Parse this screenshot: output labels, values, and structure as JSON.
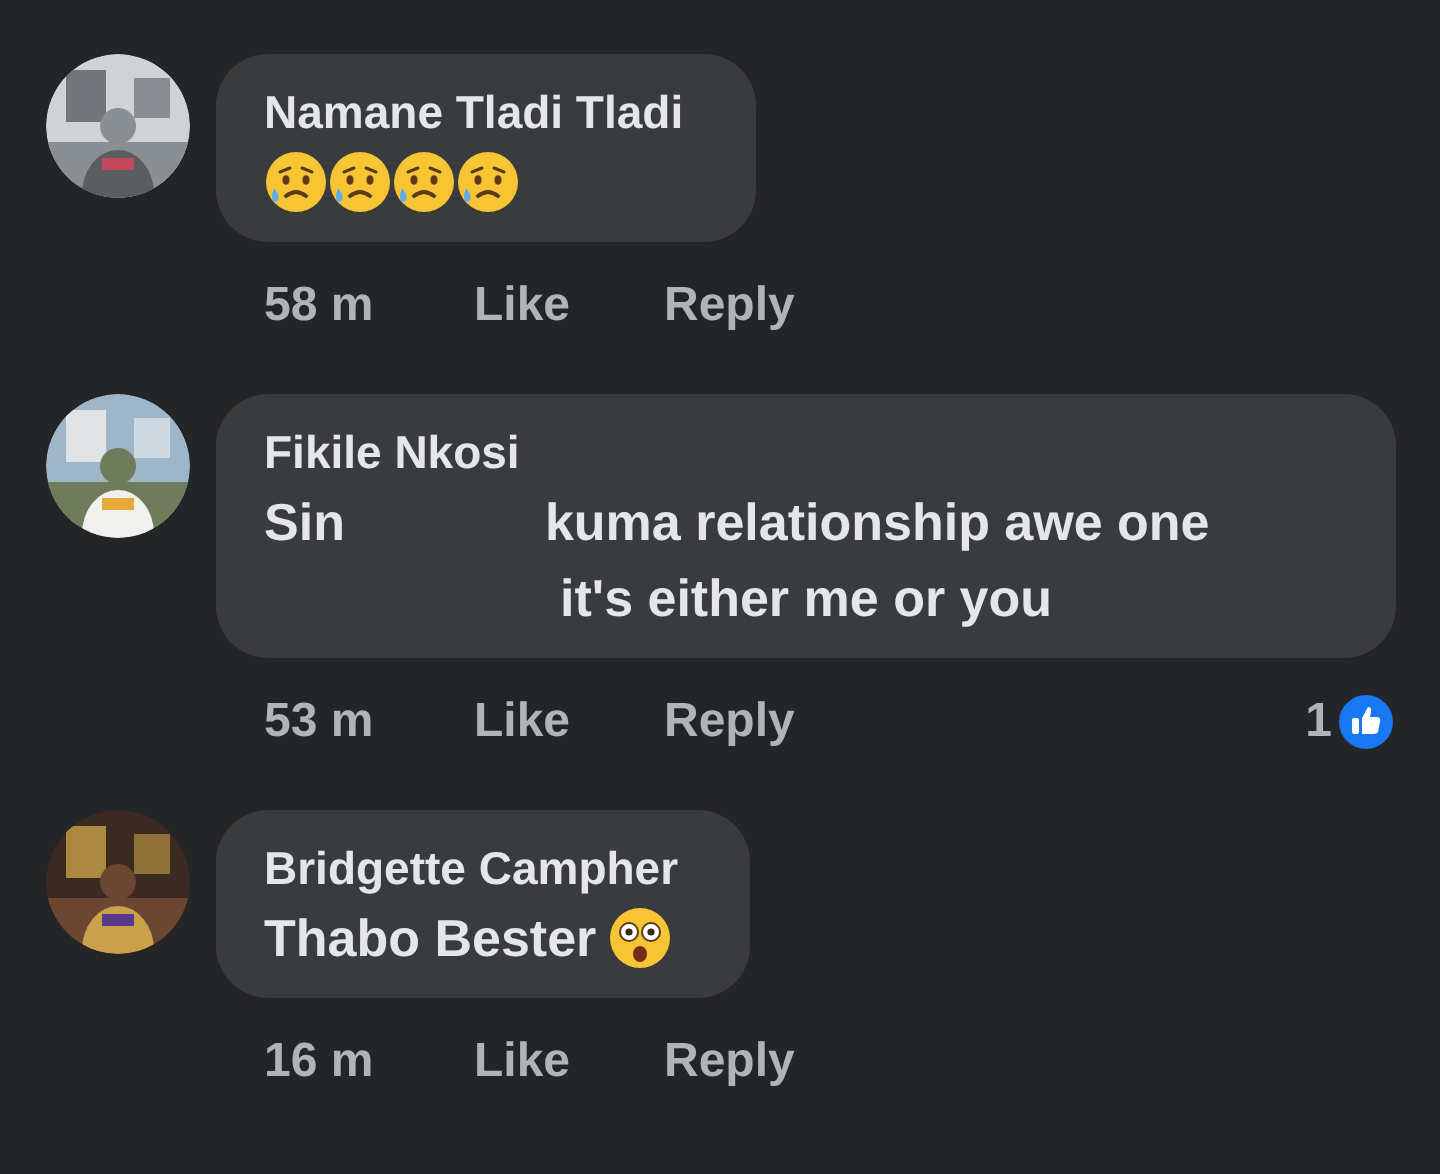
{
  "comments": [
    {
      "author": "Namane Tladi Tladi",
      "avatar": {
        "kind": "picture"
      },
      "emoji": [
        {
          "kind": "sad"
        },
        {
          "kind": "sad"
        },
        {
          "kind": "sad"
        },
        {
          "kind": "sad"
        }
      ],
      "time": "58 m",
      "like": "Like",
      "reply": "Reply"
    },
    {
      "author": "Fikile Nkosi",
      "avatar": {
        "kind": "picture"
      },
      "lines": [
        [
          "Sin",
          "kuma relationship awe one"
        ],
        [
          "it's either me or you"
        ]
      ],
      "time": "53 m",
      "like": "Like",
      "reply": "Reply",
      "reactions": "1"
    },
    {
      "author": "Bridgette Campher",
      "avatar": {
        "kind": "picture"
      },
      "lines": [
        [
          "Thabo Bester"
        ]
      ],
      "emoji": [
        {
          "kind": "astonished"
        }
      ],
      "time": "16 m",
      "like": "Like",
      "reply": "Reply"
    }
  ]
}
